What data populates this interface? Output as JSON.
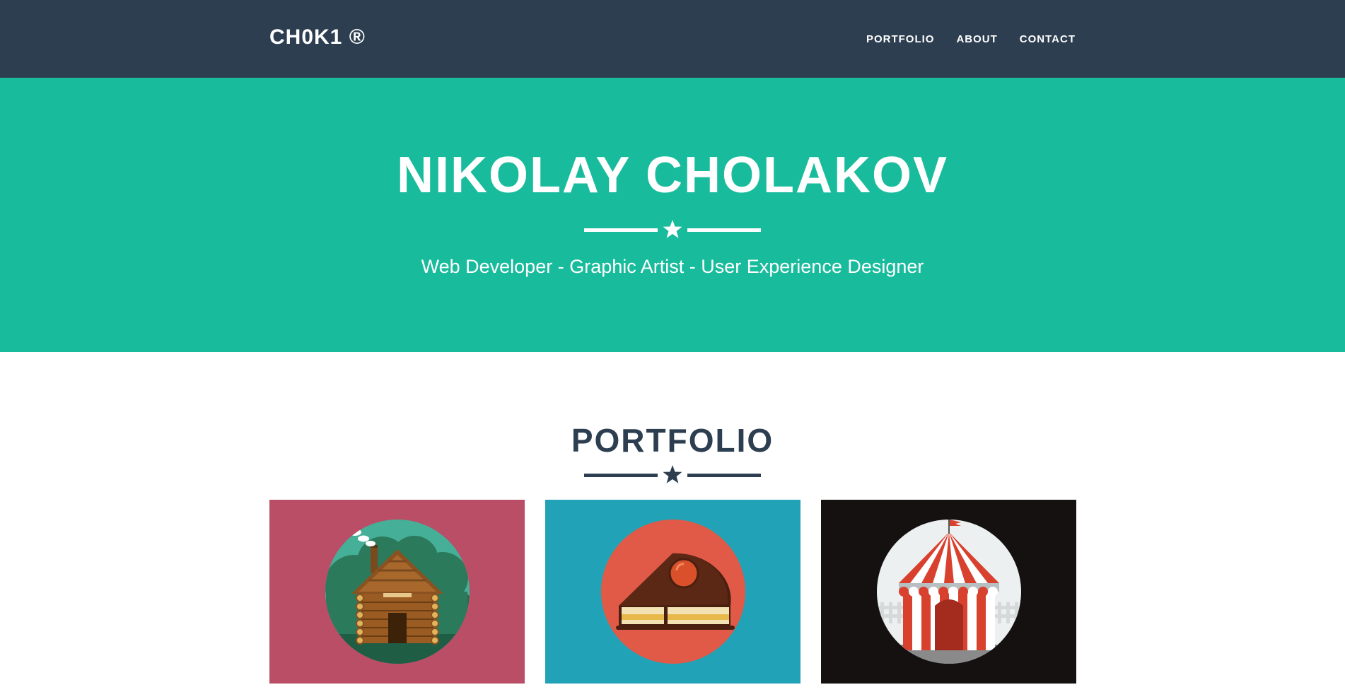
{
  "navbar": {
    "brand": "CH0K1 ®",
    "links": [
      "PORTFOLIO",
      "ABOUT",
      "CONTACT"
    ]
  },
  "hero": {
    "title": "NIKOLAY CHOLAKOV",
    "subtitle": "Web Developer - Graphic Artist - User Experience Designer"
  },
  "portfolio": {
    "title": "PORTFOLIO",
    "items": [
      {
        "icon": "log-cabin-icon",
        "background": "#b94e66"
      },
      {
        "icon": "cake-slice-icon",
        "background": "#22a2b6"
      },
      {
        "icon": "circus-tent-icon",
        "background": "#141110"
      }
    ]
  },
  "colors": {
    "navbar": "#2c3e50",
    "hero": "#18bc9c",
    "text_dark": "#2c3e50",
    "text_light": "#ffffff"
  }
}
